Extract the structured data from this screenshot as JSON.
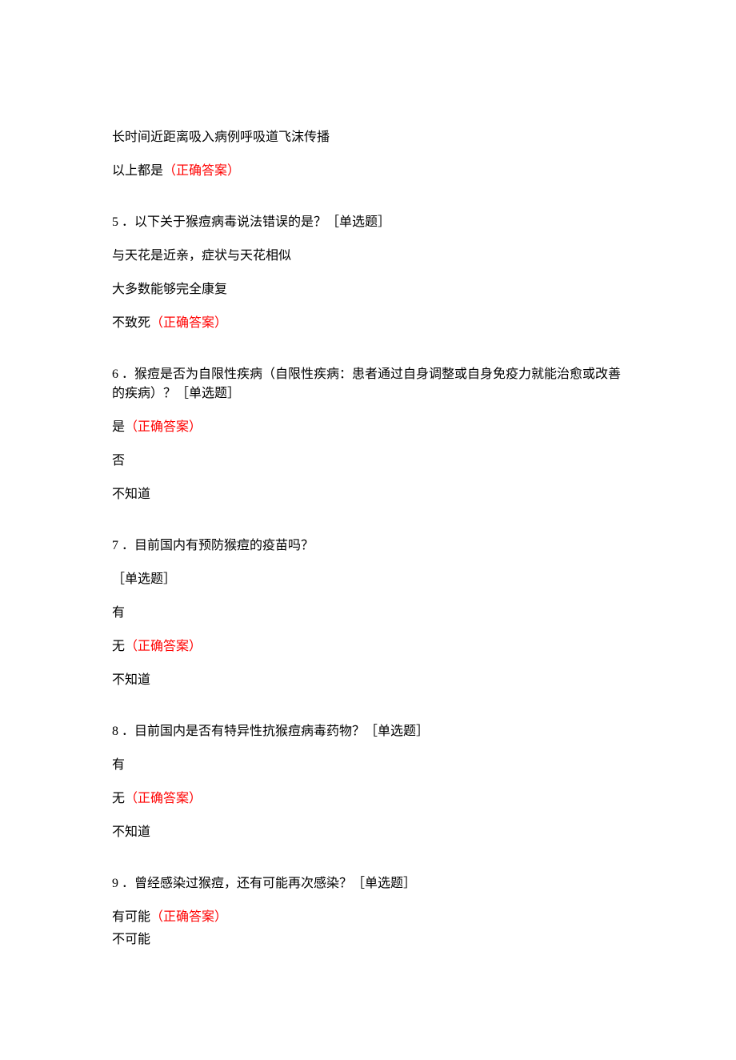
{
  "intro": {
    "line1": "长时间近距离吸入病例呼吸道飞沫传播",
    "line2_prefix": "以上都是",
    "line2_correct": "（正确答案）"
  },
  "q5": {
    "stem": "5 ．以下关于猴痘病毒说法错误的是？［单选题］",
    "opt1": "与天花是近亲，症状与天花相似",
    "opt2": "大多数能够完全康复",
    "opt3_prefix": "不致死",
    "opt3_correct": "（正确答案）"
  },
  "q6": {
    "stem": "6 ．猴痘是否为自限性疾病（自限性疾病：患者通过自身调整或自身免疫力就能治愈或改善的疾病）？［单选题］",
    "opt1_prefix": "是",
    "opt1_correct": "（正确答案）",
    "opt2": "否",
    "opt3": "不知道"
  },
  "q7": {
    "stem_line1": "7 ．目前国内有预防猴痘的疫苗吗？",
    "stem_line2": "［单选题］",
    "opt1": "有",
    "opt2_prefix": "无",
    "opt2_correct": "（正确答案）",
    "opt3": "不知道"
  },
  "q8": {
    "stem": "8 ．目前国内是否有特异性抗猴痘病毒药物？［单选题］",
    "opt1": "有",
    "opt2_prefix": "无",
    "opt2_correct": "（正确答案）",
    "opt3": "不知道"
  },
  "q9": {
    "stem": "9 ．曾经感染过猴痘，还有可能再次感染？［单选题］",
    "opt1_prefix": "有可能",
    "opt1_correct": "（正确答案）",
    "opt2": "不可能"
  }
}
